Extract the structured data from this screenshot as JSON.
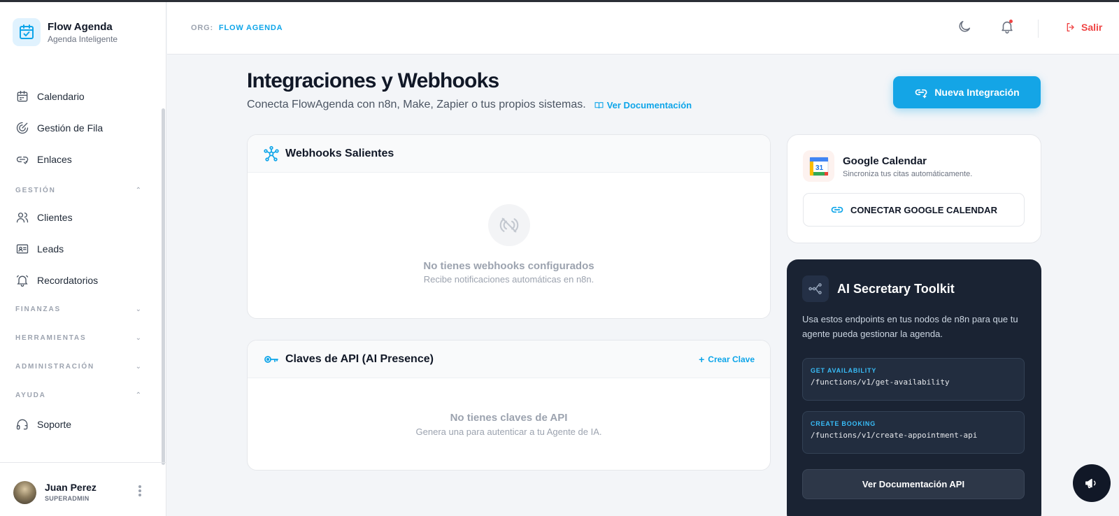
{
  "brand": {
    "name": "Flow Agenda",
    "subtitle": "Agenda Inteligente"
  },
  "sidebar": {
    "items": [
      {
        "label": "Calendario",
        "icon": "calendar-icon"
      },
      {
        "label": "Gestión de Fila",
        "icon": "queue-icon"
      },
      {
        "label": "Enlaces",
        "icon": "link-icon"
      }
    ],
    "sections": [
      {
        "label": "GESTIÓN",
        "expanded": true,
        "items": [
          {
            "label": "Clientes",
            "icon": "users-icon"
          },
          {
            "label": "Leads",
            "icon": "id-card-icon"
          },
          {
            "label": "Recordatorios",
            "icon": "bell-ring-icon"
          }
        ]
      },
      {
        "label": "FINANZAS",
        "expanded": false
      },
      {
        "label": "HERRAMIENTAS",
        "expanded": false
      },
      {
        "label": "ADMINISTRACIÓN",
        "expanded": false
      },
      {
        "label": "AYUDA",
        "expanded": true,
        "items": [
          {
            "label": "Soporte",
            "icon": "headset-icon"
          }
        ]
      }
    ]
  },
  "user": {
    "name": "Juan Perez",
    "role": "SUPERADMIN"
  },
  "header": {
    "org_label": "ORG:",
    "org_value": "FLOW AGENDA",
    "logout_label": "Salir"
  },
  "page": {
    "title": "Integraciones y Webhooks",
    "subtitle": "Conecta FlowAgenda con n8n, Make, Zapier o tus propios sistemas.",
    "doc_link": "Ver Documentación",
    "new_button": "Nueva Integración"
  },
  "webhooks": {
    "title": "Webhooks Salientes",
    "empty_title": "No tienes webhooks configurados",
    "empty_sub": "Recibe notificaciones automáticas en n8n."
  },
  "api_keys": {
    "title": "Claves de API (AI Presence)",
    "action": "Crear Clave",
    "empty_title": "No tienes claves de API",
    "empty_sub": "Genera una para autenticar a tu Agente de IA."
  },
  "google_calendar": {
    "title": "Google Calendar",
    "subtitle": "Sincroniza tus citas automáticamente.",
    "logo_day": "31",
    "button": "CONECTAR GOOGLE CALENDAR"
  },
  "ai_toolkit": {
    "title": "AI Secretary Toolkit",
    "description": "Usa estos endpoints en tus nodos de n8n para que tu agente pueda gestionar la agenda.",
    "endpoints": [
      {
        "label": "GET AVAILABILITY",
        "path": "/functions/v1/get-availability"
      },
      {
        "label": "CREATE BOOKING",
        "path": "/functions/v1/create-appointment-api"
      }
    ],
    "button": "Ver Documentación API"
  },
  "colors": {
    "accent": "#0ea5e9",
    "danger": "#ef4444",
    "dark_panel": "#1a2333"
  }
}
